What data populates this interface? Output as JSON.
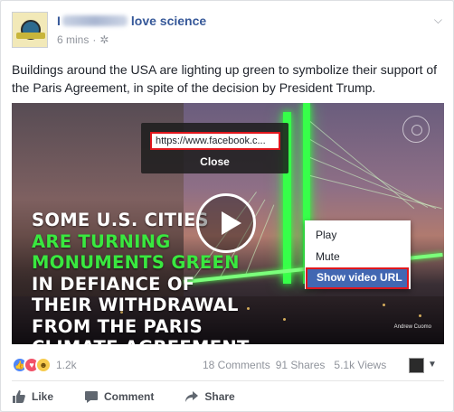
{
  "post": {
    "page_name_prefix": "I",
    "page_name_suffix": "love science",
    "timestamp": "6 mins",
    "privacy_icon": "gear-icon",
    "text": "Buildings around the USA are lighting up green to symbolize their support of the Paris Agreement, in spite of the decision by President Trump."
  },
  "video": {
    "headline_line1": "SOME U.S. CITIES",
    "headline_green1": "ARE TURNING",
    "headline_green2": "MONUMENTS GREEN",
    "headline_line4": "IN DEFIANCE OF",
    "headline_line5": "THEIR WITHDRAWAL",
    "headline_line6": "FROM THE PARIS",
    "headline_line7": "CLIMATE AGREEMENT.",
    "credit": "Andrew Cuomo",
    "url_popup": {
      "url_value": "https://www.facebook.c...",
      "close_label": "Close"
    },
    "context_menu": {
      "items": [
        "Play",
        "Mute",
        "Show video URL"
      ],
      "highlighted": "Show video URL"
    }
  },
  "stats": {
    "reaction_count": "1.2k",
    "comments": "18 Comments",
    "shares": "91 Shares",
    "views": "5.1k Views"
  },
  "actions": {
    "like": "Like",
    "comment": "Comment",
    "share": "Share"
  },
  "colors": {
    "link_blue": "#365899",
    "menu_highlight": "#4267b2",
    "annotation_red": "#e0161c",
    "headline_green": "#39e83f"
  }
}
